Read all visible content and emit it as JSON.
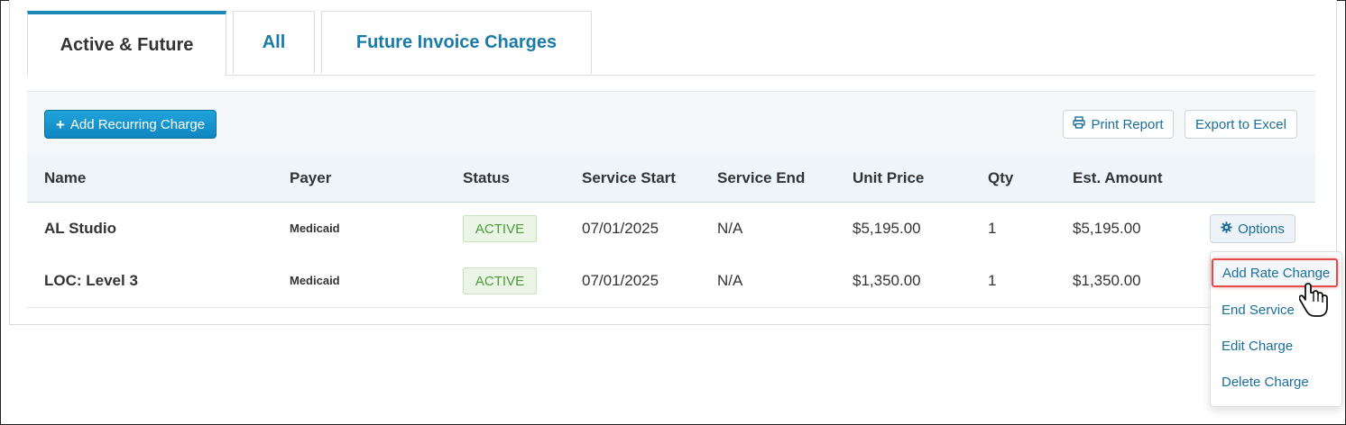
{
  "tabs": [
    {
      "label": "Active & Future",
      "active": true
    },
    {
      "label": "All",
      "active": false
    },
    {
      "label": "Future Invoice Charges",
      "active": false
    }
  ],
  "toolbar": {
    "add_label": "Add Recurring Charge",
    "add_icon": "plus-icon",
    "print_label": "Print Report",
    "print_icon": "print-icon",
    "excel_label": "Export to Excel"
  },
  "table": {
    "headers": [
      "Name",
      "Payer",
      "Status",
      "Service Start",
      "Service End",
      "Unit Price",
      "Qty",
      "Est. Amount"
    ],
    "rows": [
      {
        "name": "AL Studio",
        "payer": "Medicaid",
        "status": "ACTIVE",
        "start": "07/01/2025",
        "end": "N/A",
        "unit_price": "$5,195.00",
        "qty": "1",
        "amount": "$5,195.00"
      },
      {
        "name": "LOC: Level 3",
        "payer": "Medicaid",
        "status": "ACTIVE",
        "start": "07/01/2025",
        "end": "N/A",
        "unit_price": "$1,350.00",
        "qty": "1",
        "amount": "$1,350.00"
      }
    ],
    "options_label": "Options",
    "options_icon": "gear-icon"
  },
  "dropdown": {
    "items": [
      "Add Rate Change",
      "End Service",
      "Edit Charge",
      "Delete Charge"
    ],
    "highlighted": "Add Rate Change"
  },
  "colors": {
    "accent": "#1b86b8",
    "primary_button": "#1893cc",
    "link": "#1a6e9a",
    "active_badge_bg": "#eaf5e6",
    "active_badge_text": "#4c9a3a",
    "highlight_border": "#e04b4b"
  }
}
